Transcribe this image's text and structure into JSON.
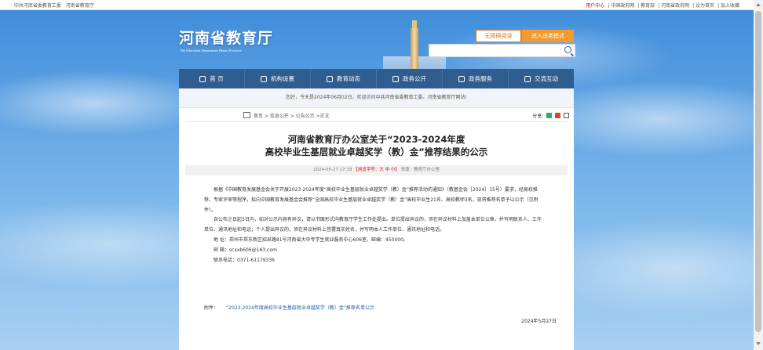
{
  "topbar": {
    "left_items": [
      "· 中共河南省委教育工委",
      "河南省教育厅"
    ],
    "right_items": [
      {
        "label": "用户中心",
        "highlight": true
      },
      {
        "label": "| 中国政府网",
        "highlight": false
      },
      {
        "label": "| 教育部",
        "highlight": false
      },
      {
        "label": "| 河南省政府网",
        "highlight": false
      },
      {
        "label": "| 设为首页",
        "highlight": false
      },
      {
        "label": "| 加入收藏",
        "highlight": false
      }
    ]
  },
  "header": {
    "logo_cn": "河南省教育厅",
    "logo_en": "The Education Department Henan Province",
    "barrier_free": "无障碍阅读",
    "elder_mode": "进入适老模式",
    "search_placeholder": ""
  },
  "nav": [
    {
      "label": "首 页",
      "icon": "home-icon"
    },
    {
      "label": "机构设置",
      "icon": "building-icon"
    },
    {
      "label": "教育动态",
      "icon": "news-icon"
    },
    {
      "label": "政务公开",
      "icon": "document-icon"
    },
    {
      "label": "政务服务",
      "icon": "service-icon"
    },
    {
      "label": "交流互动",
      "icon": "chat-icon"
    }
  ],
  "greeting": "您好，今天是2024年06月02日，欢迎访问中共河南省委教育工委、河南省教育厅网站!",
  "breadcrumb": "首页 > 信息公开 > 公告公示 >正文",
  "share_label": "分享:",
  "article": {
    "title_line1": "河南省教育厅办公室关于“2023-2024年度",
    "title_line2": "高校毕业生基层就业卓越奖学（教）金”推荐结果的公示",
    "meta_date": "2024-05-27 17:33",
    "meta_font": "【浏览字号：大 中 小】",
    "meta_source": "来源：教育厅办公室",
    "paragraphs": [
      "根据《中国教育发展基金会关于开展2023-2024年度“高校毕业生基层就业卓越奖学（教）金”推荐活动的通知》（教基金会［2024］15号）要求，经高校推荐、专家评审等程序，拟向中国教育发展基金会推荐“全国高校毕业生基层就业卓越奖学（教）金”高校毕业生21名、高校教师3名。现将推荐名单予以公示（见附件）。",
      "自公布之日起3日内，如对公示内容有异议，请以书面形式向教育厅学生工作处提出。单位提出异议的，须在异议材料上加盖本单位公章，并写明联系人、工作单位、通讯地址和电话；个人提出异议的，须在异议材料上签署真实姓名，并写明本人工作单位、通讯地址和电话。",
      "地 址：郑州市郑东新区招采路81号河南省大中专学生就业服务中心606室，邮编：450000。",
      "邮 箱：scxxb606@163.com",
      "联系电话：0371-61179336"
    ],
    "attachment_label": "附件：",
    "attachment_link": "“2023-2024年度高校毕业生基层就业卓越奖学（教）金”推荐名单公示",
    "date": "2024年5月27日"
  }
}
